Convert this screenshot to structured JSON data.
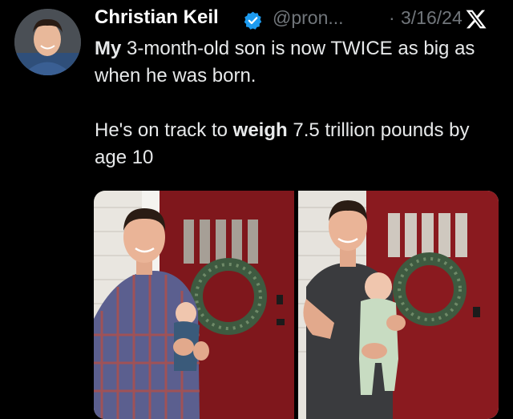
{
  "author": {
    "name": "Christian Keil",
    "handle": "@pron...",
    "separator": "·",
    "date": "3/16/24",
    "verified": true,
    "verified_color": "#1d9bf0"
  },
  "icons": {
    "verified": "verified-badge-icon",
    "platform": "x-logo-icon"
  },
  "tweet": {
    "line1_bold": "My",
    "line1_rest": " 3-month-old son is now TWICE as big as when he was born.",
    "line2_before": "He's on track to ",
    "line2_bold": "weigh",
    "line2_after": " 7.5 trillion pounds by age 10"
  },
  "media": {
    "photos": [
      "photo-newborn-plaid-shirt",
      "photo-three-months-tshirt"
    ]
  },
  "colors": {
    "background": "#000000",
    "text": "#e7e9ea",
    "muted": "#71767b",
    "door": "#8a1a1f"
  }
}
